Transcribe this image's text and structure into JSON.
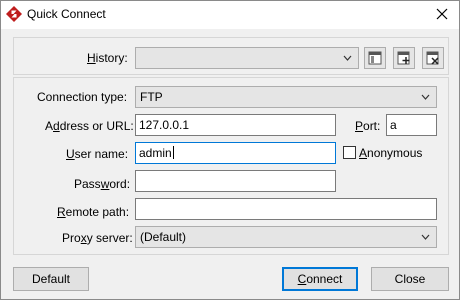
{
  "window": {
    "title": "Quick Connect",
    "app_icon": "filezilla-logo-icon",
    "close_icon": "close-icon"
  },
  "history": {
    "label_prefix": "",
    "label_ul": "H",
    "label_rest": "istory:",
    "value": "",
    "icons": [
      "history-browse-icon",
      "history-add-icon",
      "history-delete-icon"
    ]
  },
  "connection_type": {
    "label_prefix": "Connection type:",
    "value": "FTP"
  },
  "address": {
    "label_prefix": "A",
    "label_ul": "d",
    "label_rest": "dress or URL:",
    "value": "127.0.0.1"
  },
  "port": {
    "label_ul": "P",
    "label_rest": "ort:",
    "value": "a"
  },
  "username": {
    "label_ul": "U",
    "label_rest": "ser name:",
    "value": "admin"
  },
  "anonymous": {
    "label_ul": "A",
    "label_rest": "nonymous",
    "checked": false
  },
  "password": {
    "label_prefix": "Pass",
    "label_ul": "w",
    "label_rest": "ord:",
    "value": ""
  },
  "remote_path": {
    "label_ul": "R",
    "label_rest": "emote path:",
    "value": ""
  },
  "proxy": {
    "label_prefix": "Pro",
    "label_ul": "x",
    "label_rest": "y server:",
    "value": "(Default)"
  },
  "buttons": {
    "default": "Default",
    "connect_ul": "C",
    "connect_rest": "onnect",
    "close": "Close"
  }
}
